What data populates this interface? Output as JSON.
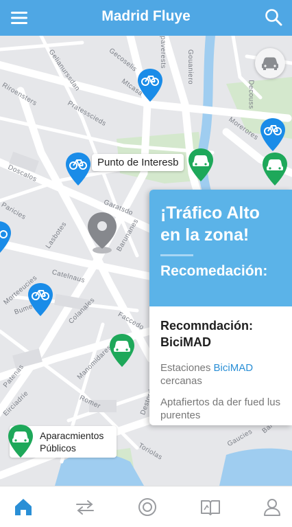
{
  "header": {
    "title": "Madrid Fluye",
    "menu_icon": "menu-icon",
    "search_icon": "search-icon"
  },
  "map": {
    "poi_label": "Punto de Interesb",
    "parking_label": "Aparacmientos Públicos",
    "streets": [
      "Gecoselis",
      "Spaverests",
      "Gouaniero",
      "Riroensters",
      "Gelianurssdan",
      "Pratesscieds",
      "Doscalos",
      "Garatsdo",
      "Morerores",
      "Paricies",
      "Lasbotes",
      "Barunanes",
      "Morteeucies",
      "Catelnaus",
      "Colanales",
      "Romer",
      "Patenas",
      "Manomidares",
      "Faccedo",
      "Destordoss",
      "Toriolas",
      "Gaucies",
      "Decouss",
      "Mtcasa",
      "Eirciadrie",
      "Bumenes",
      "Barerlo"
    ],
    "colors": {
      "bike": "#1a8ce8",
      "parking": "#1ea85a",
      "header": "#4fa7e4",
      "water": "#8fc7ef",
      "park": "#cfe6c8"
    }
  },
  "panel": {
    "alert": "¡Tráfico Alto en la zona!",
    "recommendation_heading": "Recomedación:",
    "recommendation_title": "Recomndación: BiciMAD",
    "stations_prefix": "Estaciones ",
    "stations_highlight": "BiciMAD",
    "stations_suffix": "cercanas",
    "note": "Aptafiertos da der fued lus purentes"
  },
  "nav": {
    "items": [
      {
        "icon": "home-icon",
        "active": true
      },
      {
        "icon": "transit-icon",
        "active": false
      },
      {
        "icon": "target-icon",
        "active": false
      },
      {
        "icon": "map-book-icon",
        "active": false
      },
      {
        "icon": "profile-icon",
        "active": false
      }
    ]
  }
}
